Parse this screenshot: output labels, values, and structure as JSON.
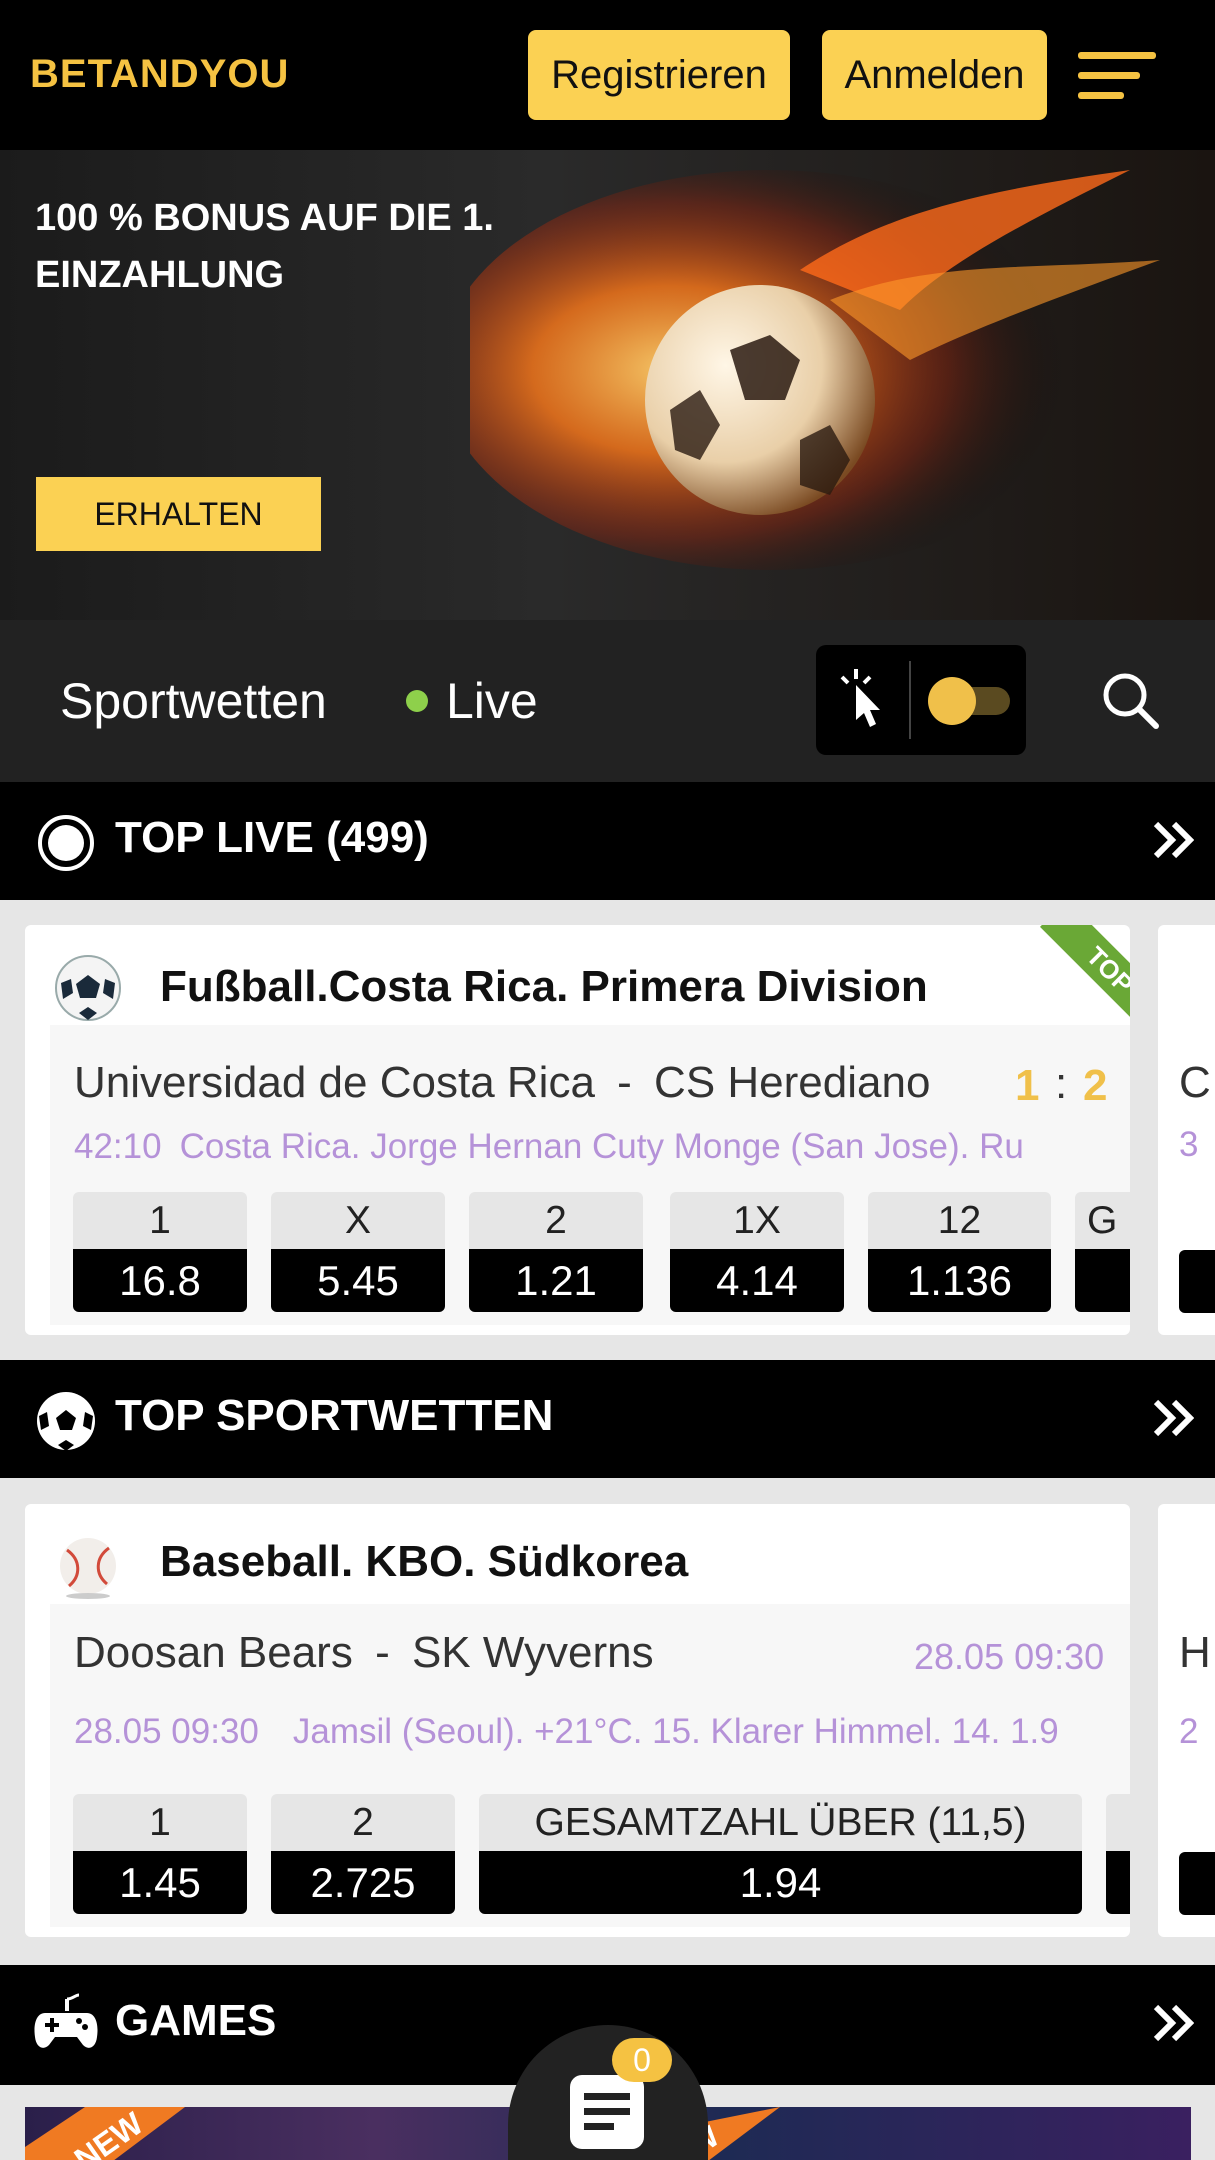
{
  "header": {
    "logo": "BETANDYOU",
    "register_label": "Registrieren",
    "login_label": "Anmelden",
    "menu_icon": "hamburger-menu-icon"
  },
  "banner": {
    "title": "100 % BONUS AUF DIE 1. EINZAHLUNG",
    "cta_label": "ERHALTEN",
    "image": "flaming-soccer-ball"
  },
  "nav": {
    "sports_label": "Sportwetten",
    "live_label": "Live",
    "toggle_icon": "click-hand-icon",
    "search_icon": "search-icon"
  },
  "top_live": {
    "title": "TOP LIVE (499)",
    "icon": "live-radio-icon",
    "card": {
      "league": "Fußball.Costa Rica. Primera Division",
      "league_icon": "soccer-ball-icon",
      "ribbon": "TOP",
      "home_team": "Universidad de Costa Rica",
      "away_team": "CS Herediano",
      "team_sep": "-",
      "home_score": "1",
      "away_score": "2",
      "score_sep": ":",
      "match_time": "42:10",
      "venue": "Costa Rica. Jorge Hernan Cuty Monge (San Jose). Ru",
      "odds": [
        {
          "label": "1",
          "value": "16.8"
        },
        {
          "label": "X",
          "value": "5.45"
        },
        {
          "label": "2",
          "value": "1.21"
        },
        {
          "label": "1X",
          "value": "4.14"
        },
        {
          "label": "12",
          "value": "1.136"
        },
        {
          "label": "G",
          "value": ""
        }
      ]
    },
    "peek": {
      "line1": "C",
      "line2": "3"
    }
  },
  "top_sports": {
    "title": "TOP SPORTWETTEN",
    "icon": "soccer-ball-icon",
    "card": {
      "league": "Baseball. KBO. Südkorea",
      "league_icon": "baseball-icon",
      "home_team": "Doosan Bears",
      "away_team": "SK Wyverns",
      "team_sep": "-",
      "start_time": "28.05 09:30",
      "date_time": "28.05 09:30",
      "venue": "Jamsil (Seoul). +21°C. 15. Klarer Himmel. 14. 1.9",
      "odds": [
        {
          "label": "1",
          "value": "1.45"
        },
        {
          "label": "2",
          "value": "2.725"
        },
        {
          "label": "GESAMTZAHL ÜBER (11,5)",
          "value": "1.94"
        }
      ]
    },
    "peek": {
      "line1": "H",
      "line2": "2"
    }
  },
  "games": {
    "title": "GAMES",
    "icon": "gamepad-icon",
    "badge_label": "NEW"
  },
  "betslip": {
    "count": "0",
    "icon": "betslip-icon"
  },
  "colors": {
    "accent": "#fbd153",
    "live_dot": "#8ed04b",
    "info_text": "#b592d8",
    "score": "#f0c04a",
    "ribbon": "#6aa836"
  }
}
